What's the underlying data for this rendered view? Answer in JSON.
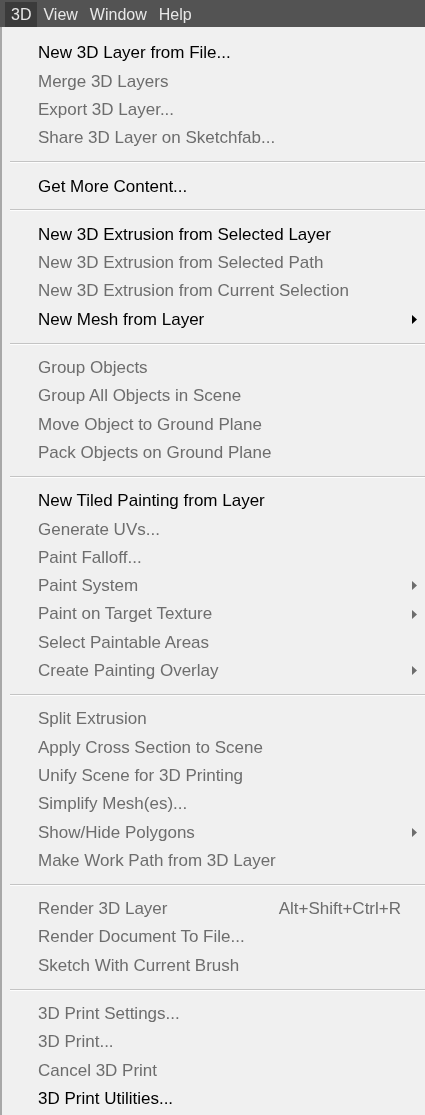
{
  "menu_bar": [
    {
      "label": "3D",
      "selected": true
    },
    {
      "label": "View",
      "selected": false
    },
    {
      "label": "Window",
      "selected": false
    },
    {
      "label": "Help",
      "selected": false
    }
  ],
  "menu_sections": [
    {
      "items": [
        {
          "label": "New 3D Layer from File...",
          "disabled": false
        },
        {
          "label": "Merge 3D Layers",
          "disabled": true
        },
        {
          "label": "Export 3D Layer...",
          "disabled": true
        },
        {
          "label": "Share 3D Layer on Sketchfab...",
          "disabled": true
        }
      ]
    },
    {
      "items": [
        {
          "label": "Get More Content...",
          "disabled": false
        }
      ]
    },
    {
      "items": [
        {
          "label": "New 3D Extrusion from Selected Layer",
          "disabled": false
        },
        {
          "label": "New 3D Extrusion from Selected Path",
          "disabled": true
        },
        {
          "label": "New 3D Extrusion from Current Selection",
          "disabled": true
        },
        {
          "label": "New Mesh from Layer",
          "disabled": false,
          "submenu": true
        }
      ]
    },
    {
      "items": [
        {
          "label": "Group Objects",
          "disabled": true
        },
        {
          "label": "Group All Objects in Scene",
          "disabled": true
        },
        {
          "label": "Move Object to Ground Plane",
          "disabled": true
        },
        {
          "label": "Pack Objects on Ground Plane",
          "disabled": true
        }
      ]
    },
    {
      "items": [
        {
          "label": "New Tiled Painting from Layer",
          "disabled": false
        },
        {
          "label": "Generate UVs...",
          "disabled": true
        },
        {
          "label": "Paint Falloff...",
          "disabled": true
        },
        {
          "label": "Paint System",
          "disabled": true,
          "submenu": true
        },
        {
          "label": "Paint on Target Texture",
          "disabled": true,
          "submenu": true
        },
        {
          "label": "Select Paintable Areas",
          "disabled": true
        },
        {
          "label": "Create Painting Overlay",
          "disabled": true,
          "submenu": true
        }
      ]
    },
    {
      "items": [
        {
          "label": "Split Extrusion",
          "disabled": true
        },
        {
          "label": "Apply Cross Section to Scene",
          "disabled": true
        },
        {
          "label": "Unify Scene for 3D Printing",
          "disabled": true
        },
        {
          "label": "Simplify Mesh(es)...",
          "disabled": true
        },
        {
          "label": "Show/Hide Polygons",
          "disabled": true,
          "submenu": true
        },
        {
          "label": "Make Work Path from 3D Layer",
          "disabled": true
        }
      ]
    },
    {
      "items": [
        {
          "label": "Render 3D Layer",
          "disabled": true,
          "shortcut": "Alt+Shift+Ctrl+R"
        },
        {
          "label": "Render Document To File...",
          "disabled": true
        },
        {
          "label": "Sketch With Current Brush",
          "disabled": true
        }
      ]
    },
    {
      "items": [
        {
          "label": "3D Print Settings...",
          "disabled": true
        },
        {
          "label": "3D Print...",
          "disabled": true
        },
        {
          "label": "Cancel 3D Print",
          "disabled": true
        },
        {
          "label": "3D Print Utilities...",
          "disabled": false
        }
      ]
    }
  ]
}
